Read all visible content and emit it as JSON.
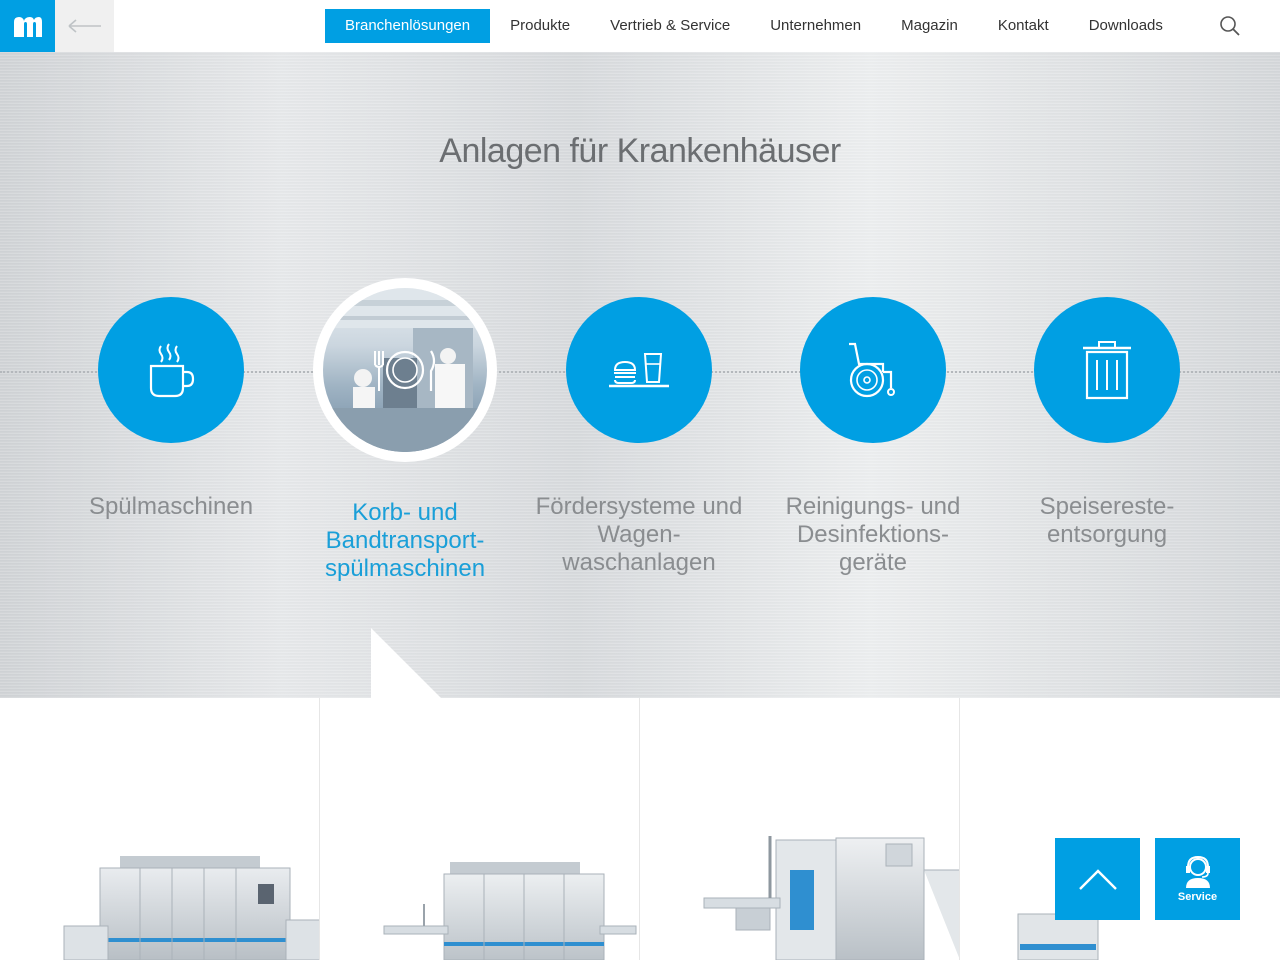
{
  "brand": {
    "logo_letter": "m",
    "accent": "#009fe3"
  },
  "nav": {
    "items": [
      {
        "label": "Branchenlösungen",
        "active": true
      },
      {
        "label": "Produkte"
      },
      {
        "label": "Vertrieb & Service"
      },
      {
        "label": "Unternehmen"
      },
      {
        "label": "Magazin"
      },
      {
        "label": "Kontakt"
      },
      {
        "label": "Downloads"
      }
    ],
    "search_icon": "search-icon",
    "back_icon": "arrow-left-icon"
  },
  "hero": {
    "title": "Anlagen für Krankenhäuser",
    "categories": [
      {
        "label": "Spülmaschinen",
        "icon": "coffee-cup-icon"
      },
      {
        "label": "Korb- und Bandtransport-spülmaschinen",
        "icon": "plate-cutlery-icon",
        "active": true
      },
      {
        "label": "Fördersysteme und Wagen-waschanlagen",
        "icon": "tray-burger-glass-icon"
      },
      {
        "label": "Reinigungs- und Desinfektions-geräte",
        "icon": "wheelchair-icon"
      },
      {
        "label": "Speisereste-entsorgung",
        "icon": "trash-can-icon"
      }
    ]
  },
  "floating": {
    "scroll_top_icon": "chevron-up-icon",
    "service_label": "Service",
    "service_icon": "headset-agent-icon"
  }
}
